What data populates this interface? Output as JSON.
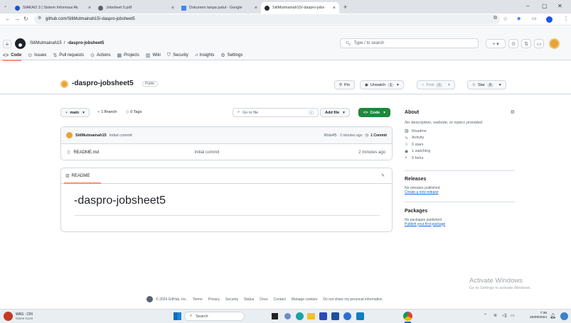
{
  "browser": {
    "tabs": [
      {
        "label": "SIAKAD 3 | Sistem Informasi Ak",
        "color": "#1a56c4"
      },
      {
        "label": "Jobsheet 5.pdf",
        "color": "#5f6368"
      },
      {
        "label": "Dokumen tanpa judul - Google",
        "color": "#4285f4"
      },
      {
        "label": "SitiMutmainah15/-daspro-jobs",
        "color": "#24292f"
      }
    ],
    "url": "github.com/SitiMutmainah15/-daspro-jobsheet5"
  },
  "gh": {
    "breadcrumb_owner": "SitiMutmainah15",
    "breadcrumb_sep": "/",
    "breadcrumb_repo": "-daspro-jobsheet5",
    "search_placeholder": "Type / to search",
    "nav": [
      "Code",
      "Issues",
      "Pull requests",
      "Actions",
      "Projects",
      "Wiki",
      "Security",
      "Insights",
      "Settings"
    ]
  },
  "repo": {
    "name": "-daspro-jobsheet5",
    "visibility": "Public",
    "pin": "Pin",
    "unwatch": "Unwatch",
    "watch_count": "1",
    "fork": "Fork",
    "fork_count": "0",
    "star": "Star",
    "star_count": "0",
    "branch": "main",
    "branches": "1 Branch",
    "tags": "0 Tags",
    "goto_placeholder": "Go to file",
    "shortcut": "t",
    "add_file": "Add file",
    "code": "Code",
    "commit_author": "SitiMutmainah15",
    "commit_msg": "Initial commit",
    "commit_meta": "96da4f5 · 2 minutes ago",
    "commit_count": "1 Commit",
    "files": [
      {
        "name": "README.md",
        "message": "Initial commit",
        "time": "2 minutes ago"
      }
    ],
    "readme_tab": "README",
    "readme_heading": "-daspro-jobsheet5"
  },
  "about": {
    "title": "About",
    "desc": "No description, website, or topics provided.",
    "items": [
      "Readme",
      "Activity",
      "0 stars",
      "1 watching",
      "0 forks"
    ],
    "releases_title": "Releases",
    "releases_none": "No releases published",
    "releases_link": "Create a new release",
    "packages_title": "Packages",
    "packages_none": "No packages published",
    "packages_link": "Publish your first package"
  },
  "footer": {
    "copyright": "© 2024 GitHub, Inc.",
    "links": [
      "Terms",
      "Privacy",
      "Security",
      "Status",
      "Docs",
      "Contact",
      "Manage cookies",
      "Do not share my personal information"
    ]
  },
  "watermark": {
    "line1": "Activate Windows",
    "line2": "Go to Settings to activate Windows."
  },
  "taskbar": {
    "weather_title": "WAS : CIN",
    "weather_sub": "Game score",
    "search": "Search",
    "time": "7:36",
    "date": "25/09/2024"
  },
  "colors": {
    "accent_green": "#1f883d",
    "link": "#0969da",
    "underline": "#fd8c73"
  }
}
